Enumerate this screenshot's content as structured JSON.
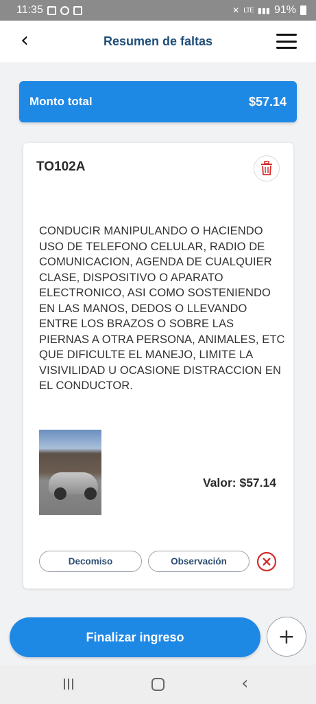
{
  "status": {
    "time": "11:35",
    "network": "LTE",
    "battery": "91%"
  },
  "header": {
    "title": "Resumen de faltas"
  },
  "total": {
    "label": "Monto total",
    "amount": "$57.14"
  },
  "infraction": {
    "code": "TO102A",
    "description": "CONDUCIR MANIPULANDO O HACIENDO USO DE TELEFONO CELULAR, RADIO DE COMUNICACION, AGENDA DE CUALQUIER CLASE, DISPOSITIVO O APARATO ELECTRONICO, ASI COMO SOSTENIENDO EN LAS MANOS, DEDOS O LLEVANDO ENTRE LOS BRAZOS O SOBRE LAS PIERNAS A OTRA PERSONA, ANIMALES, ETC QUE DIFICULTE EL MANEJO, LIMITE LA VISIVILIDAD U OCASIONE DISTRACCION EN EL CONDUCTOR.",
    "value_label": "Valor: $57.14",
    "decomiso_label": "Decomiso",
    "observacion_label": "Observación"
  },
  "actions": {
    "finalize_label": "Finalizar ingreso",
    "add_symbol": "+"
  },
  "colors": {
    "primary": "#1e88e5",
    "title": "#1f4e79",
    "danger": "#d32f2f"
  }
}
